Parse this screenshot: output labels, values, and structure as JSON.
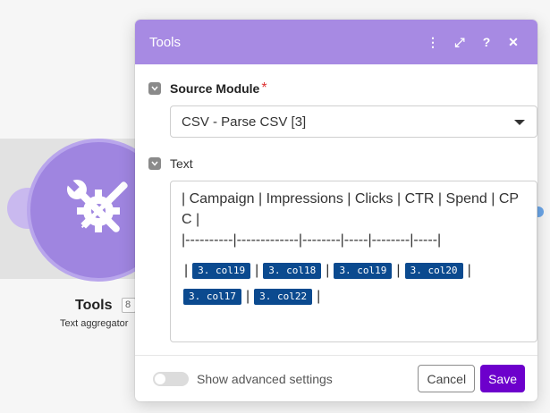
{
  "node": {
    "title": "Tools",
    "badge": "8",
    "subtitle": "Text aggregator",
    "icon": "wrench-screwdriver-gear-icon"
  },
  "dialog": {
    "title": "Tools",
    "header_icons": [
      "more-vertical-icon",
      "expand-icon",
      "help-icon",
      "close-icon"
    ],
    "header_glyphs": {
      "more": "⋮",
      "expand": "⤢",
      "help": "?",
      "close": "✕"
    },
    "source_module": {
      "label": "Source Module",
      "required_mark": "*",
      "value": "CSV - Parse CSV [3]"
    },
    "text": {
      "label": "Text",
      "header_line": "| Campaign | Impressions | Clicks | CTR | Spend | CPC |",
      "divider_line": "|----------|-------------|--------|-----|--------|-----|",
      "pills": [
        "3. col19",
        "3. col18",
        "3. col19",
        "3. col20",
        "3. col17",
        "3. col22"
      ],
      "separator": "|"
    },
    "footer": {
      "advanced_label": "Show advanced settings",
      "advanced_enabled": false,
      "cancel_label": "Cancel",
      "save_label": "Save"
    }
  },
  "colors": {
    "header_bg": "#a78ae3",
    "save_bg": "#6d00cc",
    "pill_bg": "#0b4a8f",
    "node_bg": "#9f85e0"
  }
}
